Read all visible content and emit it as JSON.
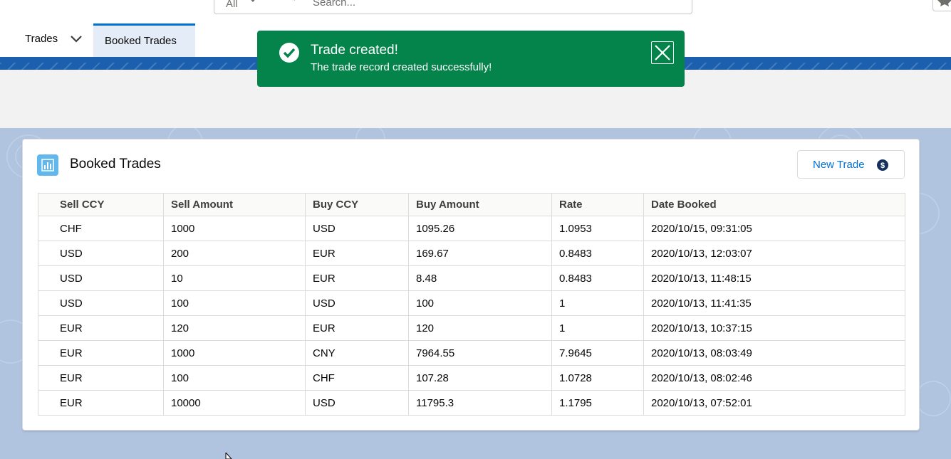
{
  "header": {
    "search_scope": "All",
    "search_placeholder": "Search...",
    "app_name": "Trades",
    "active_tab": "Booked Trades"
  },
  "toast": {
    "title": "Trade created!",
    "message": "The trade record created successfully!",
    "color": "#04844b"
  },
  "card": {
    "title": "Booked Trades",
    "new_trade_label": "New Trade",
    "icon": "chart-icon"
  },
  "table": {
    "columns": [
      "Sell CCY",
      "Sell Amount",
      "Buy CCY",
      "Buy Amount",
      "Rate",
      "Date Booked"
    ],
    "rows": [
      [
        "CHF",
        "1000",
        "USD",
        "1095.26",
        "1.0953",
        "2020/10/15, 09:31:05"
      ],
      [
        "USD",
        "200",
        "EUR",
        "169.67",
        "0.8483",
        "2020/10/13, 12:03:07"
      ],
      [
        "USD",
        "10",
        "EUR",
        "8.48",
        "0.8483",
        "2020/10/13, 11:48:15"
      ],
      [
        "USD",
        "100",
        "USD",
        "100",
        "1",
        "2020/10/13, 11:41:35"
      ],
      [
        "EUR",
        "120",
        "EUR",
        "120",
        "1",
        "2020/10/13, 10:37:15"
      ],
      [
        "EUR",
        "1000",
        "CNY",
        "7964.55",
        "7.9645",
        "2020/10/13, 08:03:49"
      ],
      [
        "EUR",
        "100",
        "CHF",
        "107.28",
        "1.0728",
        "2020/10/13, 08:02:46"
      ],
      [
        "EUR",
        "10000",
        "USD",
        "11795.3",
        "1.1795",
        "2020/10/13, 07:52:01"
      ]
    ]
  },
  "colors": {
    "brand_band": "#1b5fae",
    "background_blue": "#b0c4df",
    "link_blue": "#0070d2"
  }
}
